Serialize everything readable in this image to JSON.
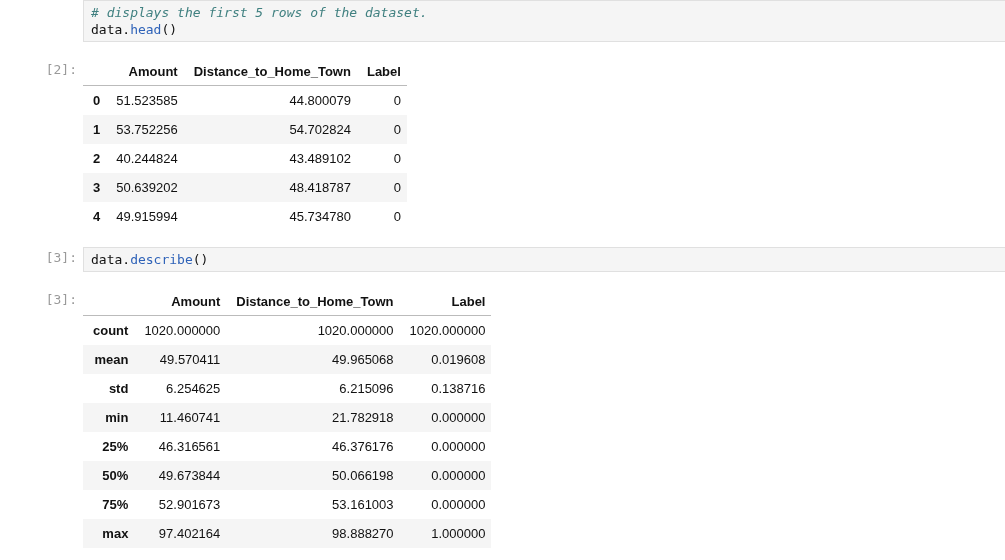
{
  "cells": [
    {
      "kind": "code",
      "lines": [
        [
          {
            "kind": "comment",
            "text": "# displays the first 5 rows of the dataset."
          }
        ],
        [
          {
            "kind": "plain",
            "text": "data."
          },
          {
            "kind": "call",
            "text": "head"
          },
          {
            "kind": "plain",
            "text": "()"
          }
        ]
      ]
    },
    {
      "kind": "table",
      "prompt": "[2]:",
      "columns": [
        "",
        "Amount",
        "Distance_to_Home_Town",
        "Label"
      ],
      "rows": [
        [
          "0",
          "51.523585",
          "44.800079",
          "0"
        ],
        [
          "1",
          "53.752256",
          "54.702824",
          "0"
        ],
        [
          "2",
          "40.244824",
          "43.489102",
          "0"
        ],
        [
          "3",
          "50.639202",
          "48.418787",
          "0"
        ],
        [
          "4",
          "49.915994",
          "45.734780",
          "0"
        ]
      ]
    },
    {
      "kind": "code",
      "prompt": "[3]:",
      "lines": [
        [
          {
            "kind": "plain",
            "text": "data."
          },
          {
            "kind": "call",
            "text": "describe"
          },
          {
            "kind": "plain",
            "text": "()"
          }
        ]
      ]
    },
    {
      "kind": "table",
      "prompt": "[3]:",
      "columns": [
        "",
        "Amount",
        "Distance_to_Home_Town",
        "Label"
      ],
      "rows": [
        [
          "count",
          "1020.000000",
          "1020.000000",
          "1020.000000"
        ],
        [
          "mean",
          "49.570411",
          "49.965068",
          "0.019608"
        ],
        [
          "std",
          "6.254625",
          "6.215096",
          "0.138716"
        ],
        [
          "min",
          "11.460741",
          "21.782918",
          "0.000000"
        ],
        [
          "25%",
          "46.316561",
          "46.376176",
          "0.000000"
        ],
        [
          "50%",
          "49.673844",
          "50.066198",
          "0.000000"
        ],
        [
          "75%",
          "52.901673",
          "53.161003",
          "0.000000"
        ],
        [
          "max",
          "97.402164",
          "98.888270",
          "1.000000"
        ]
      ]
    }
  ]
}
